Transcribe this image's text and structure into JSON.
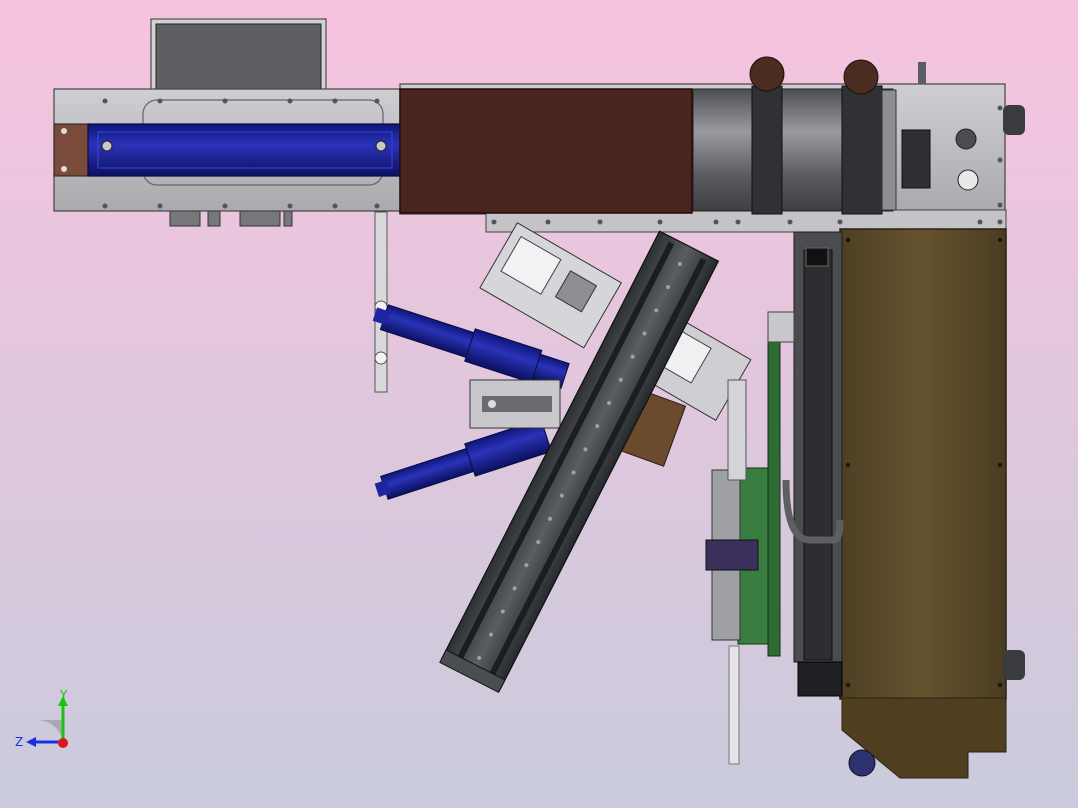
{
  "view": {
    "background_top": "#f7c3de",
    "background_bottom": "#c9cbdc"
  },
  "colors": {
    "frame_plate": "#b8b8bc",
    "cylinder_blue": "#1c238f",
    "cover_brown": "#4a2520",
    "enclosure_olive": "#5c4a2a",
    "motor_grey": "#6e6f73",
    "rail_dark": "#3a3d40",
    "pcb_green": "#2f6b34"
  },
  "triad": {
    "x_label": "",
    "y_label": "Y",
    "z_label": "Z",
    "y_color": "#19c40f",
    "z_color": "#1b2ee0",
    "origin_color": "#e0141b"
  }
}
